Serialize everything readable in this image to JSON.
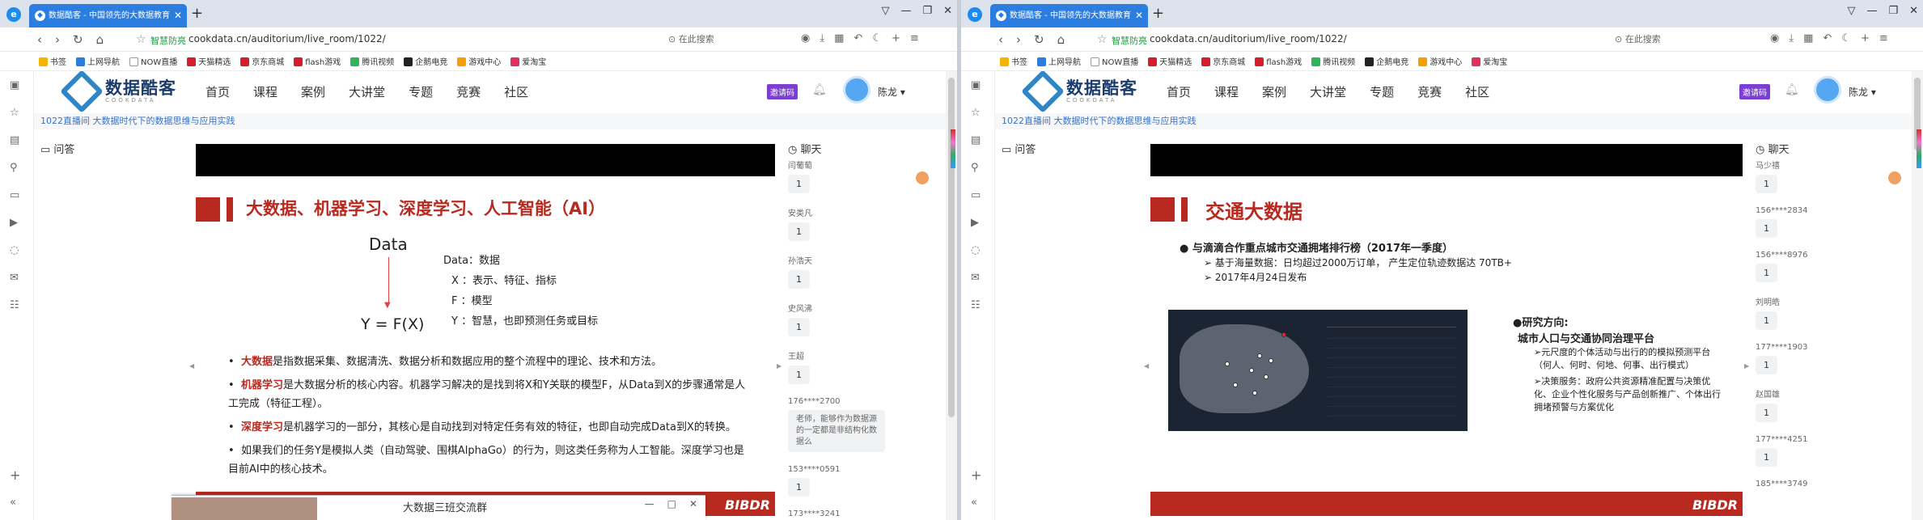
{
  "browser": {
    "tab_title": "数据酷客 - 中国领先的大数据教育",
    "url": "cookdata.cn/auditorium/live_room/1022/",
    "secure_label": "智慧防亮",
    "search_placeholder": "在此搜索",
    "bookmarks": [
      "书签",
      "上网导航",
      "NOW直播",
      "天猫精选",
      "京东商城",
      "flash游戏",
      "腾讯视频",
      "企鹅电竞",
      "游戏中心",
      "爱淘宝"
    ]
  },
  "site": {
    "brand": "数据酷客",
    "brand_sub": "COOKDATA",
    "menu": [
      "首页",
      "课程",
      "案例",
      "大讲堂",
      "专题",
      "竞赛",
      "社区"
    ],
    "invite_label": "邀请码",
    "user_name": "陈龙",
    "breadcrumb": "1022直播间 大数据时代下的数据思维与应用实践",
    "qa_label": "问答",
    "chat_label": "聊天"
  },
  "left": {
    "slide": {
      "title": "大数据、机器学习、深度学习、人工智能（AI）",
      "data_word": "Data",
      "formula": "Y = F(X)",
      "legend": [
        "Data：数据",
        "X ：表示、特征、指标",
        "F ：模型",
        "Y ：智慧，也即预测任务或目标"
      ],
      "bullets": [
        {
          "key": "大数据",
          "text": "是指数据采集、数据清洗、数据分析和数据应用的整个流程中的理论、技术和方法。"
        },
        {
          "key": "机器学习",
          "text": "是大数据分析的核心内容。机器学习解决的是找到将X和Y关联的模型F，从Data到X的步骤通常是人工完成（特征工程）。"
        },
        {
          "key": "深度学习",
          "text": "是机器学习的一部分，其核心是自动找到对特定任务有效的特征，也即自动完成Data到X的转换。"
        },
        {
          "key": "",
          "text": "如果我们的任务Y是模拟人类（自动驾驶、围棋AlphaGo）的行为，则这类任务称为人工智能。深度学习也是目前AI中的核心技术。"
        }
      ],
      "footer_logo": "BIBDR"
    },
    "chat": [
      {
        "name": "闫葡萄",
        "msg": "1"
      },
      {
        "name": "安类凡",
        "msg": "1"
      },
      {
        "name": "孙浩天",
        "msg": "1"
      },
      {
        "name": "史风沸",
        "msg": "1"
      },
      {
        "name": "王超",
        "msg": "1"
      },
      {
        "name": "176****2700",
        "msg": "老师，能够作为数据源的一定都是非结构化数据么"
      },
      {
        "name": "153****0591",
        "msg": "1"
      },
      {
        "name": "173****3241",
        "msg": ""
      }
    ],
    "popup_title": "大数据三班交流群"
  },
  "right": {
    "slide": {
      "title": "交通大数据",
      "heading": "与滴滴合作重点城市交通拥堵排行榜（2017年一季度）",
      "sub": [
        "基于海量数据：日均超过2000万订单， 产生定位轨迹数据达 70TB+",
        "2017年4月24日发布"
      ],
      "research_title": "研究方向:",
      "research_sub": "城市人口与交通协同治理平台",
      "research_items": [
        "元尺度的个体活动与出行的的模拟预测平台（何人、何时、何地、何事、出行模式）",
        "决策服务：政府公共资源精准配置与决策优化、企业个性化服务与产品创新推广、个体出行拥堵预警与方案优化"
      ],
      "footer_logo": "BIBDR"
    },
    "chat": [
      {
        "name": "马少禧",
        "msg": "1"
      },
      {
        "name": "156****2834",
        "msg": "1"
      },
      {
        "name": "156****8976",
        "msg": "1"
      },
      {
        "name": "刘明皓",
        "msg": "1"
      },
      {
        "name": "177****1903",
        "msg": "1"
      },
      {
        "name": "赵国雄",
        "msg": "1"
      },
      {
        "name": "177****4251",
        "msg": "1"
      },
      {
        "name": "185****3749",
        "msg": ""
      }
    ]
  }
}
